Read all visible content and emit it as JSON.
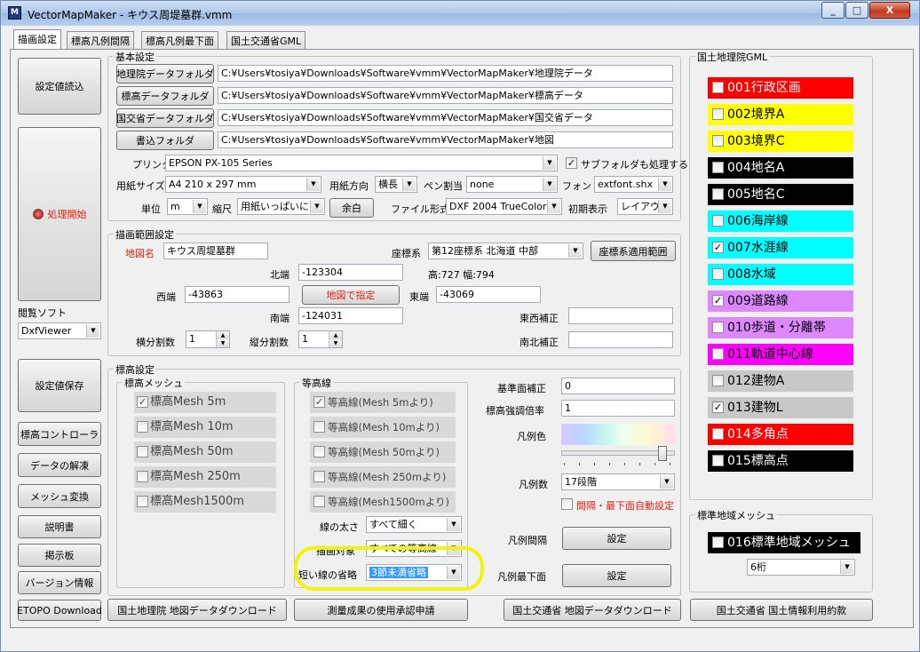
{
  "window": {
    "title": "VectorMapMaker - キウス周堤墓群.vmm",
    "minimize": "_",
    "maximize": "□",
    "close": "X"
  },
  "tabs": [
    "描画設定",
    "標高凡例間隔",
    "標高凡例最下面",
    "国土交通省GML"
  ],
  "left": {
    "load_settings": "設定値読込",
    "process_start": "処理開始",
    "viewer_label": "閲覧ソフト",
    "viewer_value": "DxfViewer",
    "save_settings": "設定値保存",
    "elev_controller": "標高コントローラ",
    "decompress": "データの解凍",
    "mesh_convert": "メッシュ変換",
    "manual": "説明書",
    "bbs": "掲示板",
    "version": "バージョン情報",
    "etopo": "ETOPO Download"
  },
  "basic": {
    "group": "基本設定",
    "gsi_folder_btn": "地理院データフォルダ",
    "gsi_folder": "C:¥Users¥tosiya¥Downloads¥Software¥vmm¥VectorMapMaker¥地理院データ",
    "elev_folder_btn": "標高データフォルダ",
    "elev_folder": "C:¥Users¥tosiya¥Downloads¥Software¥vmm¥VectorMapMaker¥標高データ",
    "mlit_folder_btn": "国交省データフォルダ",
    "mlit_folder": "C:¥Users¥tosiya¥Downloads¥Software¥vmm¥VectorMapMaker¥国交省データ",
    "out_folder_btn": "書込フォルダ",
    "out_folder": "C:¥Users¥tosiya¥Downloads¥Software¥vmm¥VectorMapMaker¥地図",
    "printer_label": "プリンタ",
    "printer_value": "EPSON PX-105 Series",
    "subfolder_label": "サブフォルダも処理する",
    "paper_label": "用紙サイズ",
    "paper_value": "A4 210 x 297 mm",
    "orient_label": "用紙方向",
    "orient_value": "横長",
    "pen_label": "ペン割当",
    "pen_value": "none",
    "font_label": "フォント",
    "font_value": "extfont.shx",
    "unit_label": "単位",
    "unit_value": "m",
    "scale_label": "縮尺",
    "scale_value": "用紙いっぱいに",
    "margin_btn": "余白",
    "format_label": "ファイル形式",
    "format_value": "DXF 2004 TrueColor",
    "initview_label": "初期表示",
    "initview_value": "レイアウト"
  },
  "range": {
    "group": "描画範囲設定",
    "mapname_label": "地図名",
    "mapname_value": "キウス周堤墓群",
    "coord_label": "座標系",
    "coord_value": "第12座標系 北海道 中部",
    "coord_btn": "座標系適用範囲",
    "north_label": "北端",
    "north_value": "-123304",
    "size_text": "高:727 幅:794",
    "west_label": "西端",
    "west_value": "-43863",
    "map_btn": "地図で指定",
    "east_label": "東端",
    "east_value": "-43069",
    "south_label": "南端",
    "south_value": "-124031",
    "ew_label": "東西補正",
    "ew_value": "",
    "ns_label": "南北補正",
    "ns_value": "",
    "hdiv_label": "横分割数",
    "hdiv_value": "1",
    "vdiv_label": "縦分割数",
    "vdiv_value": "1"
  },
  "elev": {
    "group": "標高設定",
    "mesh_group": "標高メッシュ",
    "mesh": [
      {
        "label": "標高Mesh 5m",
        "checked": true
      },
      {
        "label": "標高Mesh 10m",
        "checked": false
      },
      {
        "label": "標高Mesh 50m",
        "checked": false
      },
      {
        "label": "標高Mesh 250m",
        "checked": false
      },
      {
        "label": "標高Mesh1500m",
        "checked": false
      }
    ],
    "contour_group": "等高線",
    "contours": [
      {
        "label": "等高線(Mesh 5mより)",
        "checked": true
      },
      {
        "label": "等高線(Mesh 10mより)",
        "checked": false
      },
      {
        "label": "等高線(Mesh 50mより)",
        "checked": false
      },
      {
        "label": "等高線(Mesh 250mより)",
        "checked": false
      },
      {
        "label": "等高線(Mesh1500mより)",
        "checked": false
      }
    ],
    "linewidth_label": "線の太さ",
    "linewidth_value": "すべて細く",
    "target_label": "描画対象",
    "target_value": "すべての等高線",
    "shortline_label": "短い線の省略",
    "shortline_value": "3節未満省略",
    "base_label": "基準面補正",
    "base_value": "0",
    "exag_label": "標高強調倍率",
    "exag_value": "1",
    "legendcolor_label": "凡例色",
    "legendcount_label": "凡例数",
    "legendcount_value": "17段階",
    "autoset_label": "間隔・最下面自動設定",
    "interval_label": "凡例間隔",
    "interval_btn": "設定",
    "bottom_label": "凡例最下面",
    "bottom_btn": "設定",
    "slider_fraction": 0.92
  },
  "gml": {
    "group": "国土地理院GML",
    "items": [
      {
        "label": "001行政区画",
        "checked": false,
        "bg": "#ff0000",
        "fg": "#ffffff"
      },
      {
        "label": "002境界A",
        "checked": false,
        "bg": "#ffff00",
        "fg": "#000000"
      },
      {
        "label": "003境界C",
        "checked": false,
        "bg": "#ffff00",
        "fg": "#000000"
      },
      {
        "label": "004地名A",
        "checked": false,
        "bg": "#000000",
        "fg": "#ffffff"
      },
      {
        "label": "005地名C",
        "checked": false,
        "bg": "#000000",
        "fg": "#ffffff"
      },
      {
        "label": "006海岸線",
        "checked": false,
        "bg": "#00ffff",
        "fg": "#000000"
      },
      {
        "label": "007水涯線",
        "checked": true,
        "bg": "#00ffff",
        "fg": "#000000"
      },
      {
        "label": "008水域",
        "checked": false,
        "bg": "#00ffff",
        "fg": "#000000"
      },
      {
        "label": "009道路線",
        "checked": true,
        "bg": "#dd88ff",
        "fg": "#000000"
      },
      {
        "label": "010歩道・分離帯",
        "checked": false,
        "bg": "#dd88ff",
        "fg": "#000000"
      },
      {
        "label": "011軌道中心線",
        "checked": false,
        "bg": "#ff00ff",
        "fg": "#000000"
      },
      {
        "label": "012建物A",
        "checked": false,
        "bg": "#c8c8c8",
        "fg": "#000000"
      },
      {
        "label": "013建物L",
        "checked": true,
        "bg": "#c8c8c8",
        "fg": "#000000"
      },
      {
        "label": "014多角点",
        "checked": false,
        "bg": "#ff0000",
        "fg": "#ffffff"
      },
      {
        "label": "015標高点",
        "checked": false,
        "bg": "#000000",
        "fg": "#ffffff"
      }
    ],
    "std_group": "標準地域メッシュ",
    "std_item": "016標準地域メッシュ",
    "std_digits": "6桁"
  },
  "bottom": {
    "gsi_dl": "国土地理院 地図データダウンロード",
    "survey": "測量成果の使用承認申請",
    "mlit_dl": "国土交通省 地図データダウンロード",
    "terms": "国土交通省 国土情報利用約款"
  }
}
